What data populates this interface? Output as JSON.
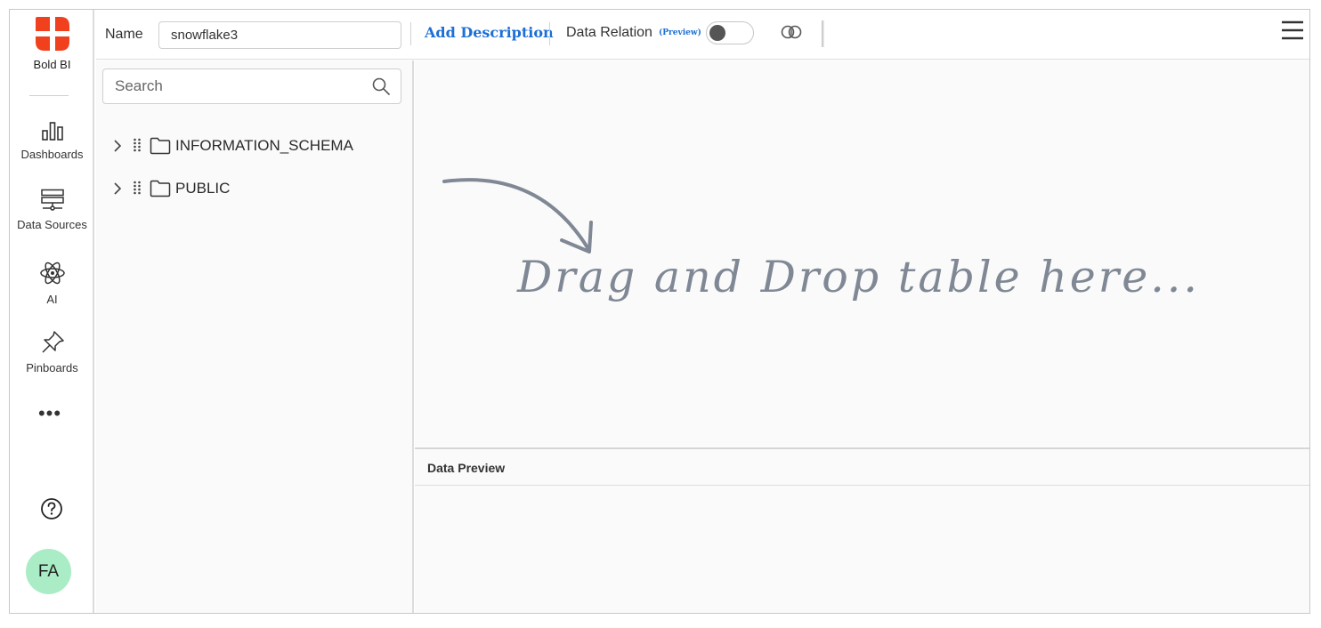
{
  "brand": {
    "name": "Bold BI",
    "accent_color": "#f0401e"
  },
  "nav": {
    "items": [
      {
        "label": "Dashboards",
        "icon": "bar-chart-icon"
      },
      {
        "label": "Data Sources",
        "icon": "server-icon"
      },
      {
        "label": "AI",
        "icon": "atom-icon"
      },
      {
        "label": "Pinboards",
        "icon": "pin-icon"
      }
    ],
    "more_label": "•••",
    "help_icon": "help-circle-icon",
    "avatar_initials": "FA",
    "avatar_color": "#a9ecc5"
  },
  "toolbar": {
    "name_label": "Name",
    "name_value": "snowflake3",
    "add_description": "Add Description",
    "data_relation_label": "Data Relation",
    "data_relation_badge": "(Preview)",
    "data_relation_enabled": false,
    "join_icon": "join-circles-icon",
    "menu_icon": "hamburger-menu-icon",
    "link_color": "#1d6fd6"
  },
  "schema": {
    "search_placeholder": "Search",
    "items": [
      {
        "label": "INFORMATION_SCHEMA",
        "icon": "folder-icon"
      },
      {
        "label": "PUBLIC",
        "icon": "folder-icon"
      }
    ]
  },
  "canvas": {
    "hint": "Drag and Drop table here..."
  },
  "preview": {
    "title": "Data Preview"
  }
}
